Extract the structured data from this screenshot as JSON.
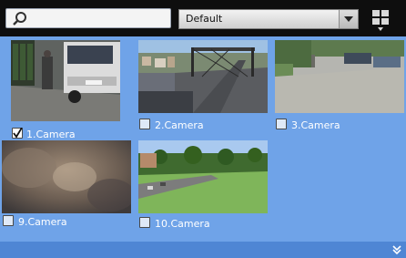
{
  "search": {
    "value": "",
    "placeholder": "",
    "icon": "search-icon"
  },
  "layout_select": {
    "selected": "Default",
    "icon": "chevron-down-icon"
  },
  "layout_button": {
    "icon": "grid-layout-icon"
  },
  "cameras": [
    {
      "label": "1.Camera",
      "checked": true
    },
    {
      "label": "2.Camera",
      "checked": false
    },
    {
      "label": "3.Camera",
      "checked": false
    },
    {
      "label": "9.Camera",
      "checked": false
    },
    {
      "label": "10.Camera",
      "checked": false
    }
  ],
  "bottom": {
    "icon": "double-chevron-down-icon"
  },
  "colors": {
    "background": "#6fa3e8",
    "topbar": "#0e0e0e",
    "bottombar": "#4f86d4"
  }
}
